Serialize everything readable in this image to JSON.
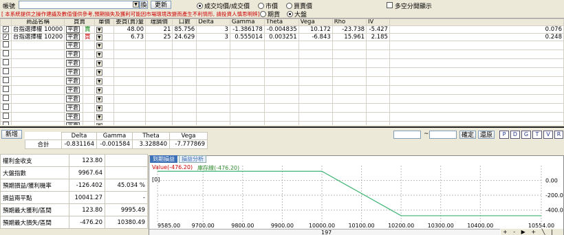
{
  "toolbar": {
    "account_label": "帳號",
    "switch_label": "換",
    "refresh_label": "更新",
    "price_options": [
      "成交均價/成交價",
      "市價",
      "買賣價"
    ],
    "price_selected": 0,
    "index_options": [
      "期貨",
      "大盤"
    ],
    "index_selected": 1,
    "multi_label": "多空分開顯示",
    "disclaimer": "[ 本系統提供之操作建議及數值僅供參考,預期損失及獲利可能因市場環境改變而產生不利情形, 請投資人慎思明辨]"
  },
  "grid": {
    "headers": [
      "商品名稱",
      "買賣",
      "單價",
      "委買(賣)量",
      "理論價",
      "口數",
      "Delta",
      "Gamma",
      "Theta",
      "Vega",
      "Rho",
      "IV"
    ],
    "rows": [
      {
        "checked": true,
        "name": "台指選擇權 10000",
        "pc": "平倉",
        "side": "賣",
        "side_color": "#008000",
        "price": "48.00",
        "qty": "21",
        "theo": "85.756",
        "lots": "3",
        "delta": "-1.386178",
        "gamma": "-0.004835",
        "theta": "10.172",
        "vega": "-23.738",
        "rho": "-5.427",
        "iv": "0.076"
      },
      {
        "checked": true,
        "name": "台指選擇權 10200",
        "pc": "平倉",
        "side": "買",
        "side_color": "#cc0000",
        "price": "6.73",
        "qty": "25",
        "theo": "24.629",
        "lots": "3",
        "delta": "0.555014",
        "gamma": "0.003251",
        "theta": "-6.843",
        "vega": "15.961",
        "rho": "2.185",
        "iv": "0.248"
      }
    ],
    "empty_pc": "平倉"
  },
  "summary": {
    "new_label": "新增",
    "headers": [
      "Delta",
      "Gamma",
      "Theta",
      "Vega"
    ],
    "total_label": "合計",
    "values": [
      "-0.831164",
      "-0.001584",
      "3.328840",
      "-7.777869"
    ]
  },
  "right_tools": {
    "tilde": "~",
    "confirm": "確定",
    "restore": "還原",
    "letters": [
      "P",
      "D",
      "G",
      "T",
      "V",
      "R"
    ]
  },
  "info": [
    {
      "label": "權利金收支",
      "v1": "123.80",
      "v2": ""
    },
    {
      "label": "大盤指數",
      "v1": "9967.64",
      "v2": ""
    },
    {
      "label": "預期損益/獲利機率",
      "v1": "-126.402",
      "v2": "45.034 %"
    },
    {
      "label": "損益兩平點",
      "v1": "10041.27",
      "v2": "-"
    },
    {
      "label": "預期最大獲利/區間",
      "v1": "123.80",
      "v2": "9995.49"
    },
    {
      "label": "預期最大損失/區間",
      "v1": "-476.20",
      "v2": "10380.49"
    }
  ],
  "chart_tabs": [
    "到期損益",
    "損益分析"
  ],
  "chart_legend": {
    "value_text": "Value(-476.20)",
    "value_color": "#cc0000",
    "curve_text": "庫存線(-476.20)",
    "curve_color": "#2e8b2e"
  },
  "chart_zero_label": "[0]",
  "chart_data": {
    "type": "line",
    "x_ticks": [
      "9585.00",
      "9700.00",
      "9800.00",
      "9900.00",
      "10000.00",
      "10100.00",
      "10200.00",
      "10300.00",
      "10400.00",
      "10554.00"
    ],
    "y_ticks": [
      "0.00",
      "-200.0",
      "-400.0"
    ],
    "series": [
      {
        "name": "庫存線",
        "x": [
          9585,
          10000,
          10200,
          10554
        ],
        "y": [
          123.8,
          123.8,
          -476.2,
          -476.2
        ],
        "color": "#3cb371"
      }
    ],
    "xlim": [
      9585,
      10554
    ],
    "ylim": [
      -560,
      200
    ],
    "cursor_x": "197"
  }
}
